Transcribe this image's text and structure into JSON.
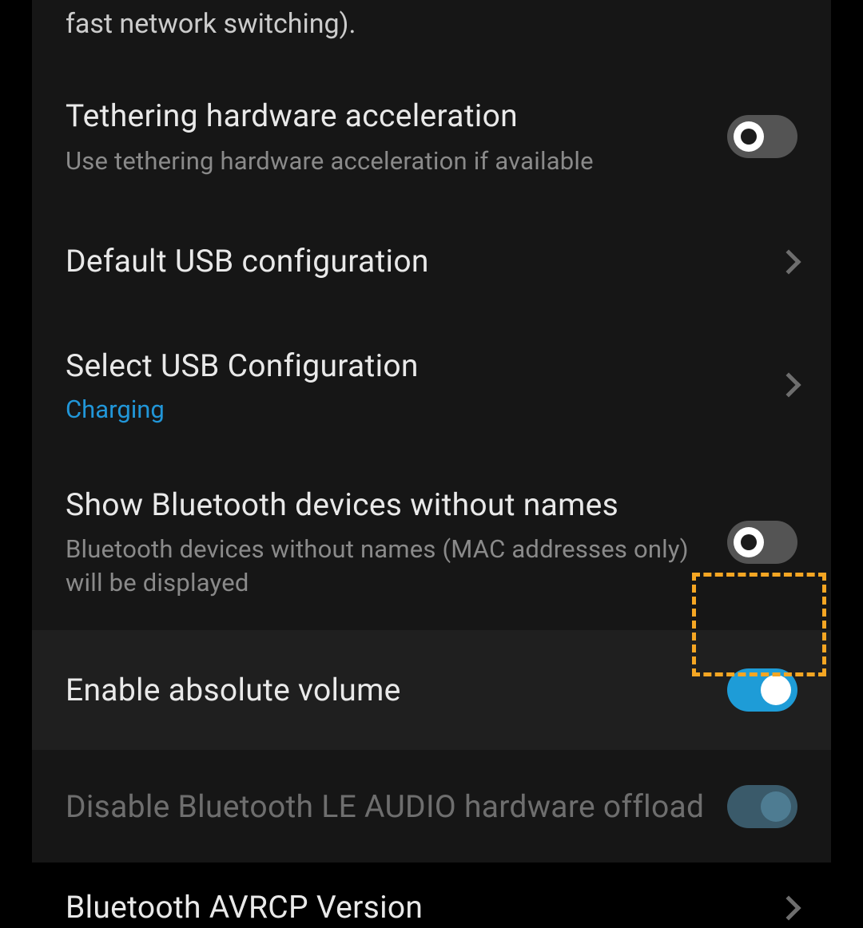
{
  "rows": {
    "partial_top": {
      "subtitle": "fast network switching)."
    },
    "tethering": {
      "title": "Tethering hardware acceleration",
      "subtitle": "Use tethering hardware acceleration if available",
      "toggle": false
    },
    "default_usb": {
      "title": "Default USB configuration"
    },
    "select_usb": {
      "title": "Select USB Configuration",
      "value": "Charging"
    },
    "bt_noname": {
      "title": "Show Bluetooth devices without names",
      "subtitle": "Bluetooth devices without names (MAC addresses only) will be displayed",
      "toggle": false
    },
    "abs_volume": {
      "title": "Enable absolute volume",
      "toggle": true,
      "highlighted": true
    },
    "le_audio": {
      "title": "Disable Bluetooth LE AUDIO hardware offload",
      "toggle": true,
      "disabled": true
    },
    "avrcp": {
      "title": "Bluetooth AVRCP Version"
    }
  },
  "colors": {
    "accent": "#1e9cd7",
    "highlight_border": "#f5a623"
  }
}
